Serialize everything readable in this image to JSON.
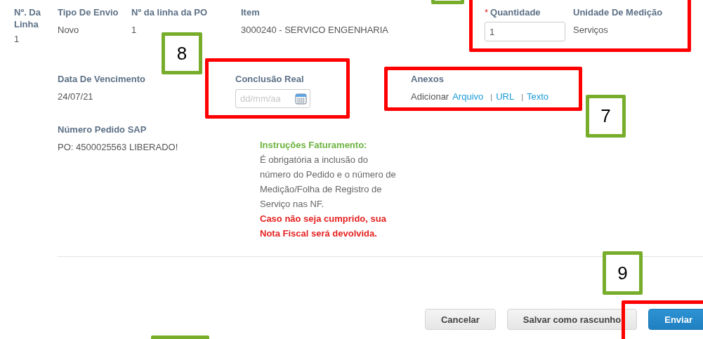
{
  "line": {
    "label": "Nº. Da Linha",
    "value": "1"
  },
  "row_1": [
    {
      "kind": "text",
      "label": "Tipo De Envio",
      "value": "Novo"
    },
    {
      "kind": "text",
      "label": "Nº da linha da PO",
      "value": "1"
    },
    {
      "kind": "text",
      "label": "Item",
      "value": "3000240 - SERVICO ENGENHARIA"
    },
    {
      "kind": "input",
      "label": "Quantidade",
      "required_mark": "*",
      "value": "1"
    },
    {
      "kind": "text",
      "label": "Unidade De Medição",
      "value": "Serviços"
    }
  ],
  "row_2": [
    {
      "kind": "text",
      "label": "Data De Vencimento",
      "value": "24/07/21"
    },
    {
      "kind": "date",
      "label": "Conclusão Real",
      "placeholder": "dd/mm/aa"
    },
    {
      "kind": "attachments",
      "label": "Anexos",
      "prefix": "Adicionar",
      "links": [
        "Arquivo",
        "URL",
        "Texto"
      ],
      "separator": "|"
    }
  ],
  "sap": {
    "label": "Número Pedido SAP",
    "value": "PO: 4500025563 LIBERADO!"
  },
  "instructions": {
    "title": "Instruções Faturamento:",
    "body": "É obrigatória a inclusão do número do Pedido e o número de Medição/Folha de Registro de Serviço nas NF.",
    "warning": "Caso não seja cumprido, sua Nota Fiscal será devolvida."
  },
  "buttons": [
    {
      "kind": "secondary",
      "label": "Cancelar"
    },
    {
      "kind": "secondary",
      "label": "Salvar como rascunho"
    },
    {
      "kind": "primary",
      "label": "Enviar"
    }
  ],
  "annotations": [
    {
      "kind": "number_box"
    },
    {
      "kind": "frame"
    },
    {
      "kind": "number_box",
      "label": "8"
    },
    {
      "kind": "frame"
    },
    {
      "kind": "frame"
    },
    {
      "kind": "number_box",
      "label": "7"
    },
    {
      "kind": "number_box",
      "label": "9"
    },
    {
      "kind": "frame"
    },
    {
      "kind": "number_box"
    }
  ]
}
